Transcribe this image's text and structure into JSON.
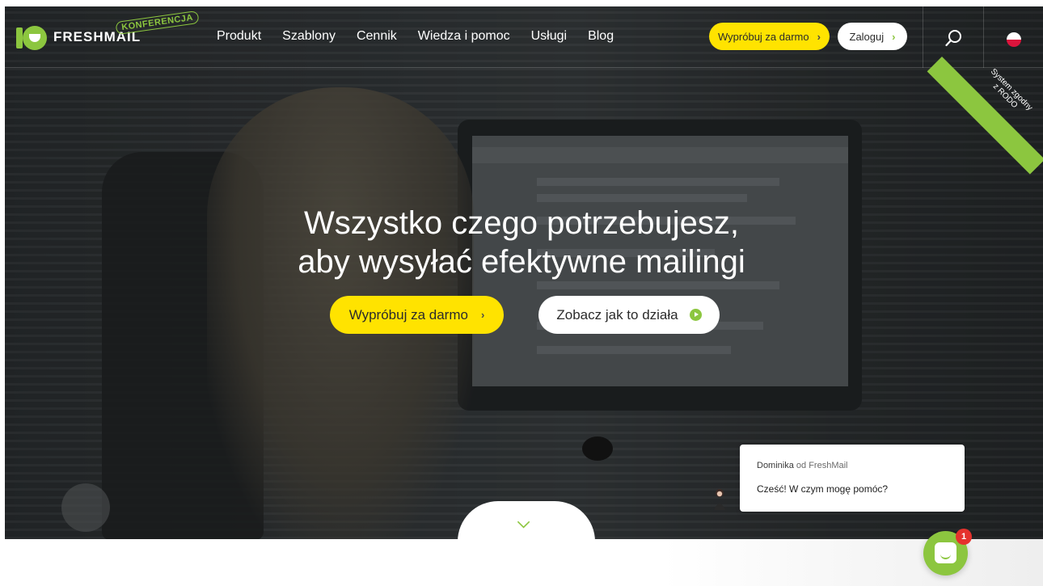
{
  "header": {
    "logo_text": "FRESHMAIL",
    "logo_badge": "KONFERENCJA",
    "nav": [
      "Produkt",
      "Szablony",
      "Cennik",
      "Wiedza i pomoc",
      "Usługi",
      "Blog"
    ],
    "try_label": "Wypróbuj za darmo",
    "login_label": "Zaloguj",
    "search_icon": "search-icon",
    "language_icon": "poland-flag-icon"
  },
  "ribbon": {
    "line1": "System zgodny",
    "line2": "z RODO"
  },
  "hero": {
    "headline_line1": "Wszystko czego potrzebujesz,",
    "headline_line2": "aby wysyłać efektywne mailingi",
    "cta_primary": "Wypróbuj za darmo",
    "cta_secondary": "Zobacz jak to działa",
    "scroll_icon": "chevron-down-icon"
  },
  "chat": {
    "agent_name": "Dominika",
    "from_suffix": "od FreshMail",
    "message": "Cześć! W czym mogę pomóc?",
    "unread_count": "1"
  },
  "colors": {
    "brand_green": "#8cc63f",
    "cta_yellow": "#ffe300",
    "badge_red": "#e5322d"
  }
}
